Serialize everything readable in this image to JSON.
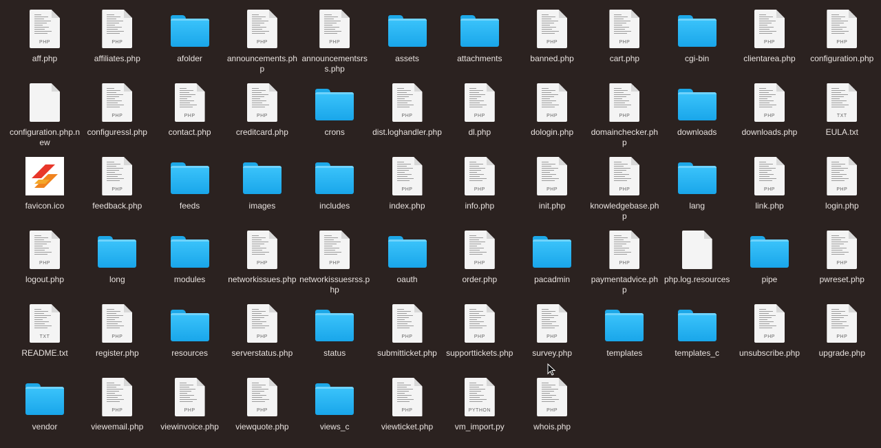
{
  "items": [
    {
      "label": "aff.php",
      "type": "file",
      "tag": "PHP"
    },
    {
      "label": "affiliates.php",
      "type": "file",
      "tag": "PHP"
    },
    {
      "label": "afolder",
      "type": "folder"
    },
    {
      "label": "announcements.php",
      "type": "file",
      "tag": "PHP"
    },
    {
      "label": "announcementsrss.php",
      "type": "file",
      "tag": "PHP"
    },
    {
      "label": "assets",
      "type": "folder"
    },
    {
      "label": "attachments",
      "type": "folder"
    },
    {
      "label": "banned.php",
      "type": "file",
      "tag": "PHP"
    },
    {
      "label": "cart.php",
      "type": "file",
      "tag": "PHP"
    },
    {
      "label": "cgi-bin",
      "type": "folder"
    },
    {
      "label": "clientarea.php",
      "type": "file",
      "tag": "PHP"
    },
    {
      "label": "configuration.php",
      "type": "file",
      "tag": "PHP"
    },
    {
      "label": "configuration.php.new",
      "type": "blank"
    },
    {
      "label": "configuressl.php",
      "type": "file",
      "tag": "PHP"
    },
    {
      "label": "contact.php",
      "type": "file",
      "tag": "PHP"
    },
    {
      "label": "creditcard.php",
      "type": "file",
      "tag": "PHP"
    },
    {
      "label": "crons",
      "type": "folder"
    },
    {
      "label": "dist.loghandler.php",
      "type": "file",
      "tag": "PHP"
    },
    {
      "label": "dl.php",
      "type": "file",
      "tag": "PHP"
    },
    {
      "label": "dologin.php",
      "type": "file",
      "tag": "PHP"
    },
    {
      "label": "domainchecker.php",
      "type": "file",
      "tag": "PHP"
    },
    {
      "label": "downloads",
      "type": "folder"
    },
    {
      "label": "downloads.php",
      "type": "file",
      "tag": "PHP"
    },
    {
      "label": "EULA.txt",
      "type": "file",
      "tag": "TXT"
    },
    {
      "label": "favicon.ico",
      "type": "favicon"
    },
    {
      "label": "feedback.php",
      "type": "file",
      "tag": "PHP"
    },
    {
      "label": "feeds",
      "type": "folder"
    },
    {
      "label": "images",
      "type": "folder"
    },
    {
      "label": "includes",
      "type": "folder"
    },
    {
      "label": "index.php",
      "type": "file",
      "tag": "PHP"
    },
    {
      "label": "info.php",
      "type": "file",
      "tag": "PHP"
    },
    {
      "label": "init.php",
      "type": "file",
      "tag": "PHP"
    },
    {
      "label": "knowledgebase.php",
      "type": "file",
      "tag": "PHP"
    },
    {
      "label": "lang",
      "type": "folder"
    },
    {
      "label": "link.php",
      "type": "file",
      "tag": "PHP"
    },
    {
      "label": "login.php",
      "type": "file",
      "tag": "PHP"
    },
    {
      "label": "logout.php",
      "type": "file",
      "tag": "PHP"
    },
    {
      "label": "long",
      "type": "folder"
    },
    {
      "label": "modules",
      "type": "folder"
    },
    {
      "label": "networkissues.php",
      "type": "file",
      "tag": "PHP"
    },
    {
      "label": "networkissuesrss.php",
      "type": "file",
      "tag": "PHP"
    },
    {
      "label": "oauth",
      "type": "folder"
    },
    {
      "label": "order.php",
      "type": "file",
      "tag": "PHP"
    },
    {
      "label": "pacadmin",
      "type": "folder"
    },
    {
      "label": "paymentadvice.php",
      "type": "file",
      "tag": "PHP"
    },
    {
      "label": "php.log.resources",
      "type": "blank"
    },
    {
      "label": "pipe",
      "type": "folder"
    },
    {
      "label": "pwreset.php",
      "type": "file",
      "tag": "PHP"
    },
    {
      "label": "README.txt",
      "type": "file",
      "tag": "TXT"
    },
    {
      "label": "register.php",
      "type": "file",
      "tag": "PHP"
    },
    {
      "label": "resources",
      "type": "folder"
    },
    {
      "label": "serverstatus.php",
      "type": "file",
      "tag": "PHP"
    },
    {
      "label": "status",
      "type": "folder"
    },
    {
      "label": "submitticket.php",
      "type": "file",
      "tag": "PHP"
    },
    {
      "label": "supporttickets.php",
      "type": "file",
      "tag": "PHP"
    },
    {
      "label": "survey.php",
      "type": "file",
      "tag": "PHP"
    },
    {
      "label": "templates",
      "type": "folder"
    },
    {
      "label": "templates_c",
      "type": "folder"
    },
    {
      "label": "unsubscribe.php",
      "type": "file",
      "tag": "PHP"
    },
    {
      "label": "upgrade.php",
      "type": "file",
      "tag": "PHP"
    },
    {
      "label": "vendor",
      "type": "folder"
    },
    {
      "label": "viewemail.php",
      "type": "file",
      "tag": "PHP"
    },
    {
      "label": "viewinvoice.php",
      "type": "file",
      "tag": "PHP"
    },
    {
      "label": "viewquote.php",
      "type": "file",
      "tag": "PHP"
    },
    {
      "label": "views_c",
      "type": "folder"
    },
    {
      "label": "viewticket.php",
      "type": "file",
      "tag": "PHP"
    },
    {
      "label": "vm_import.py",
      "type": "file",
      "tag": "PYTHON"
    },
    {
      "label": "whois.php",
      "type": "file",
      "tag": "PHP"
    }
  ],
  "colors": {
    "background": "#2b2220",
    "folder": "#29b6f6",
    "label": "#e8e2df"
  }
}
